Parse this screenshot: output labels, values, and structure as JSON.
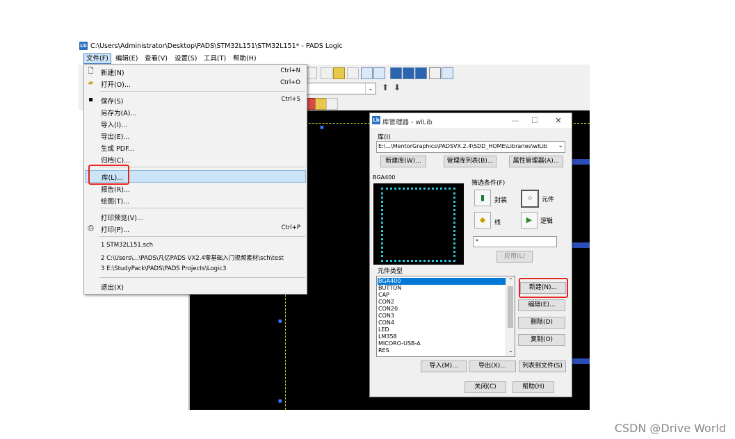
{
  "window": {
    "title": "C:\\Users\\Administrator\\Desktop\\PADS\\STM32L151\\STM32L151* - PADS Logic",
    "icon": "Lb"
  },
  "menubar": [
    "文件(F)",
    "编辑(E)",
    "查看(V)",
    "设置(S)",
    "工具(T)",
    "帮助(H)"
  ],
  "file_menu": {
    "items": [
      {
        "label": "新建(N)",
        "shortcut": "Ctrl+N",
        "icon": "new-file-icon"
      },
      {
        "label": "打开(O)...",
        "shortcut": "Ctrl+O",
        "icon": "open-folder-icon"
      },
      {
        "label": "保存(S)",
        "shortcut": "Ctrl+S",
        "icon": "save-icon"
      },
      {
        "label": "另存为(A)...",
        "shortcut": ""
      },
      {
        "label": "导入(I)...",
        "shortcut": ""
      },
      {
        "label": "导出(E)...",
        "shortcut": ""
      },
      {
        "label": "生成 PDF...",
        "shortcut": ""
      },
      {
        "label": "归档(C)...",
        "shortcut": ""
      },
      {
        "label": "库(L)...",
        "shortcut": ""
      },
      {
        "label": "报告(R)...",
        "shortcut": ""
      },
      {
        "label": "绘图(T)...",
        "shortcut": ""
      },
      {
        "label": "打印预览(V)...",
        "shortcut": ""
      },
      {
        "label": "打印(P)...",
        "shortcut": "Ctrl+P",
        "icon": "printer-icon"
      },
      {
        "label": "退出(X)",
        "shortcut": ""
      }
    ],
    "recent": [
      "1 STM32L151.sch",
      "2 C:\\Users\\...\\PADS\\凡亿PADS VX2.4零基础入门视频素材\\sch\\test",
      "3 E:\\StudyPack\\PADS\\PADS Projects\\Logic3"
    ]
  },
  "library_manager": {
    "title": "库管理器 - wlLib",
    "icon": "Lb",
    "library_group": "库(I)",
    "library_path": "E:\\...\\MentorGraphics\\PADSVX.2.4\\SDD_HOME\\Libraries\\wlLib",
    "new_library_button": "新建库(W)...",
    "manage_list_button": "管理库列表(B)...",
    "attr_manager_button": "属性管理器(A)...",
    "preview_label": "BGA400",
    "filter_group": "筛选条件(F)",
    "filter_decal": "封装",
    "filter_part": "元件",
    "filter_line": "线",
    "filter_logic": "逻辑",
    "filter_value": "*",
    "apply_button": "应用(L)",
    "part_types_group": "元件类型",
    "part_types": [
      "BGA400",
      "BUTTON",
      "CAP",
      "CON2",
      "CON20",
      "CON3",
      "CON4",
      "LED",
      "LM358",
      "MICORO-USB-A",
      "RES"
    ],
    "new_button": "新建(N)...",
    "edit_button": "编辑(E)...",
    "delete_button": "删除(D)",
    "copy_button": "复制(O)",
    "import_button": "导入(M)...",
    "export_button": "导出(X)...",
    "list_to_file_button": "列表到文件(S)",
    "close_button": "关闭(C)",
    "help_button": "帮助(H)"
  },
  "watermark": "CSDN @Drive World",
  "colors": {
    "highlight_red": "#e8231e",
    "selection_blue": "#0078d7",
    "board_outline": "#27c6d8",
    "canvas": "#000000"
  }
}
